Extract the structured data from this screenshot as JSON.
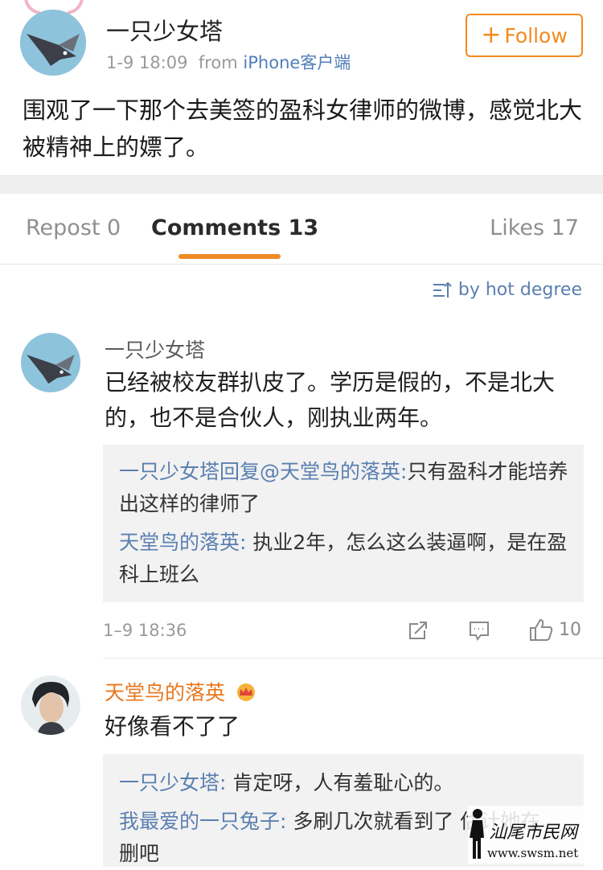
{
  "post": {
    "username": "一只少女塔",
    "time": "1-9 18:09",
    "from_label": "from",
    "source": "iPhone客户端",
    "follow_label": "Follow",
    "text": "围观了一下那个去美签的盈科女律师的微博，感觉北大被精神上的嫖了。"
  },
  "tabs": {
    "repost": "Repost 0",
    "comments": "Comments 13",
    "likes": "Likes 17"
  },
  "sort_label": "by hot degree",
  "comments": [
    {
      "username": "一只少女塔",
      "text": "已经被校友群扒皮了。学历是假的，不是北大的，也不是合伙人，刚执业两年。",
      "replies": [
        {
          "name": "一只少女塔回复@天堂鸟的落英:",
          "text": "只有盈科才能培养出这样的律师了"
        },
        {
          "name": "天堂鸟的落英:",
          "text": " 执业2年，怎么这么装逼啊，是在盈科上班么"
        }
      ],
      "time": "1–9 18:36",
      "like_count": "10"
    },
    {
      "username": "天堂鸟的落英",
      "text": "好像看不了了",
      "replies": [
        {
          "name": "一只少女塔:",
          "text": " 肯定呀，人有羞耻心的。"
        },
        {
          "name": "我最爱的一只兔子:",
          "text": " 多刷几次就看到了 估计她在删吧"
        }
      ]
    }
  ],
  "watermark": {
    "line1": "汕尾市民网",
    "line2": "www.swsm.net"
  },
  "colors": {
    "accent_orange": "#f28a1e",
    "link_blue": "#5a7fb0"
  }
}
